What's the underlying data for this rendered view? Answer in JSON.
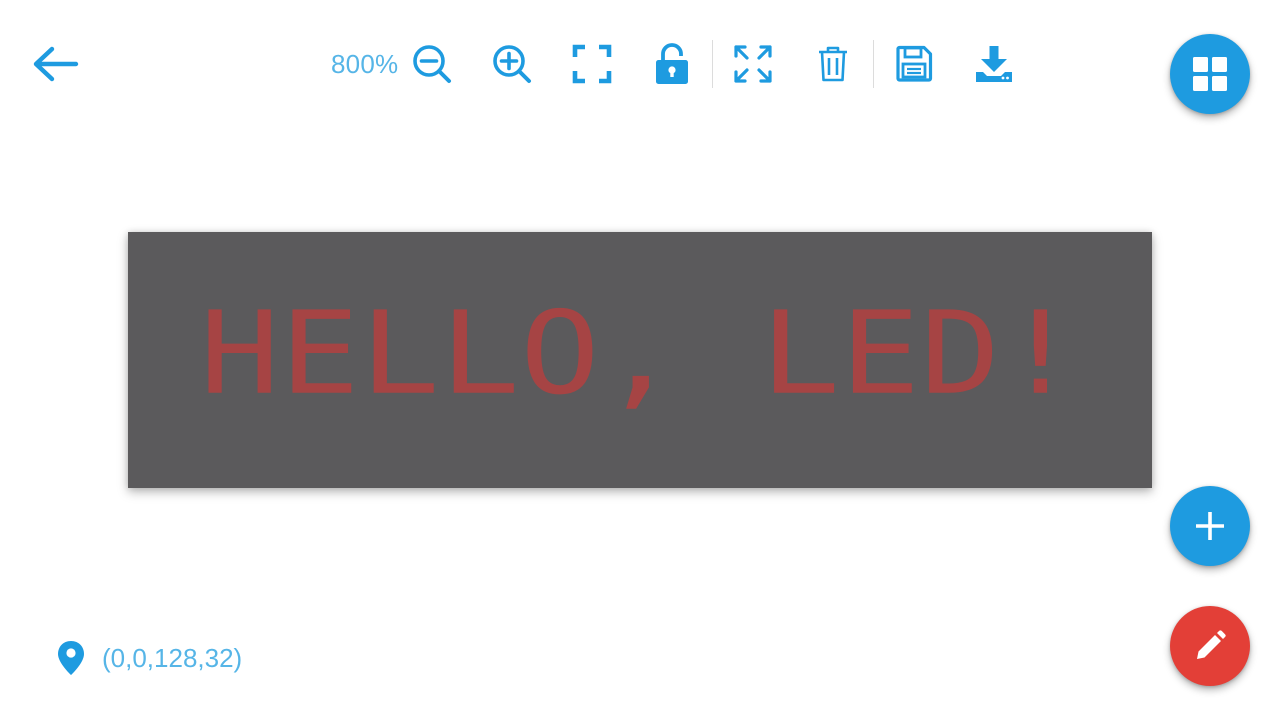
{
  "colors": {
    "accent": "#1e9be0",
    "accent_light": "#56b5e7",
    "fab_edit": "#e33f37",
    "canvas_background": "#5b5a5c",
    "led_text": "#a64444"
  },
  "header": {
    "back_icon": "arrow-left-icon"
  },
  "toolbar": {
    "zoom_label": "800%",
    "buttons": [
      {
        "icon": "zoom-out-icon"
      },
      {
        "icon": "zoom-in-icon"
      },
      {
        "icon": "fit-screen-icon"
      },
      {
        "icon": "unlock-icon"
      },
      {
        "icon": "expand-icon"
      },
      {
        "icon": "trash-icon"
      },
      {
        "icon": "save-icon"
      },
      {
        "icon": "download-icon"
      }
    ]
  },
  "fabs": {
    "grid_icon": "grid-icon",
    "add_icon": "plus-icon",
    "edit_icon": "pencil-icon"
  },
  "canvas": {
    "text": "HELLO, LED!"
  },
  "status": {
    "icon": "location-pin-icon",
    "bounds_text": "(0,0,128,32)"
  }
}
